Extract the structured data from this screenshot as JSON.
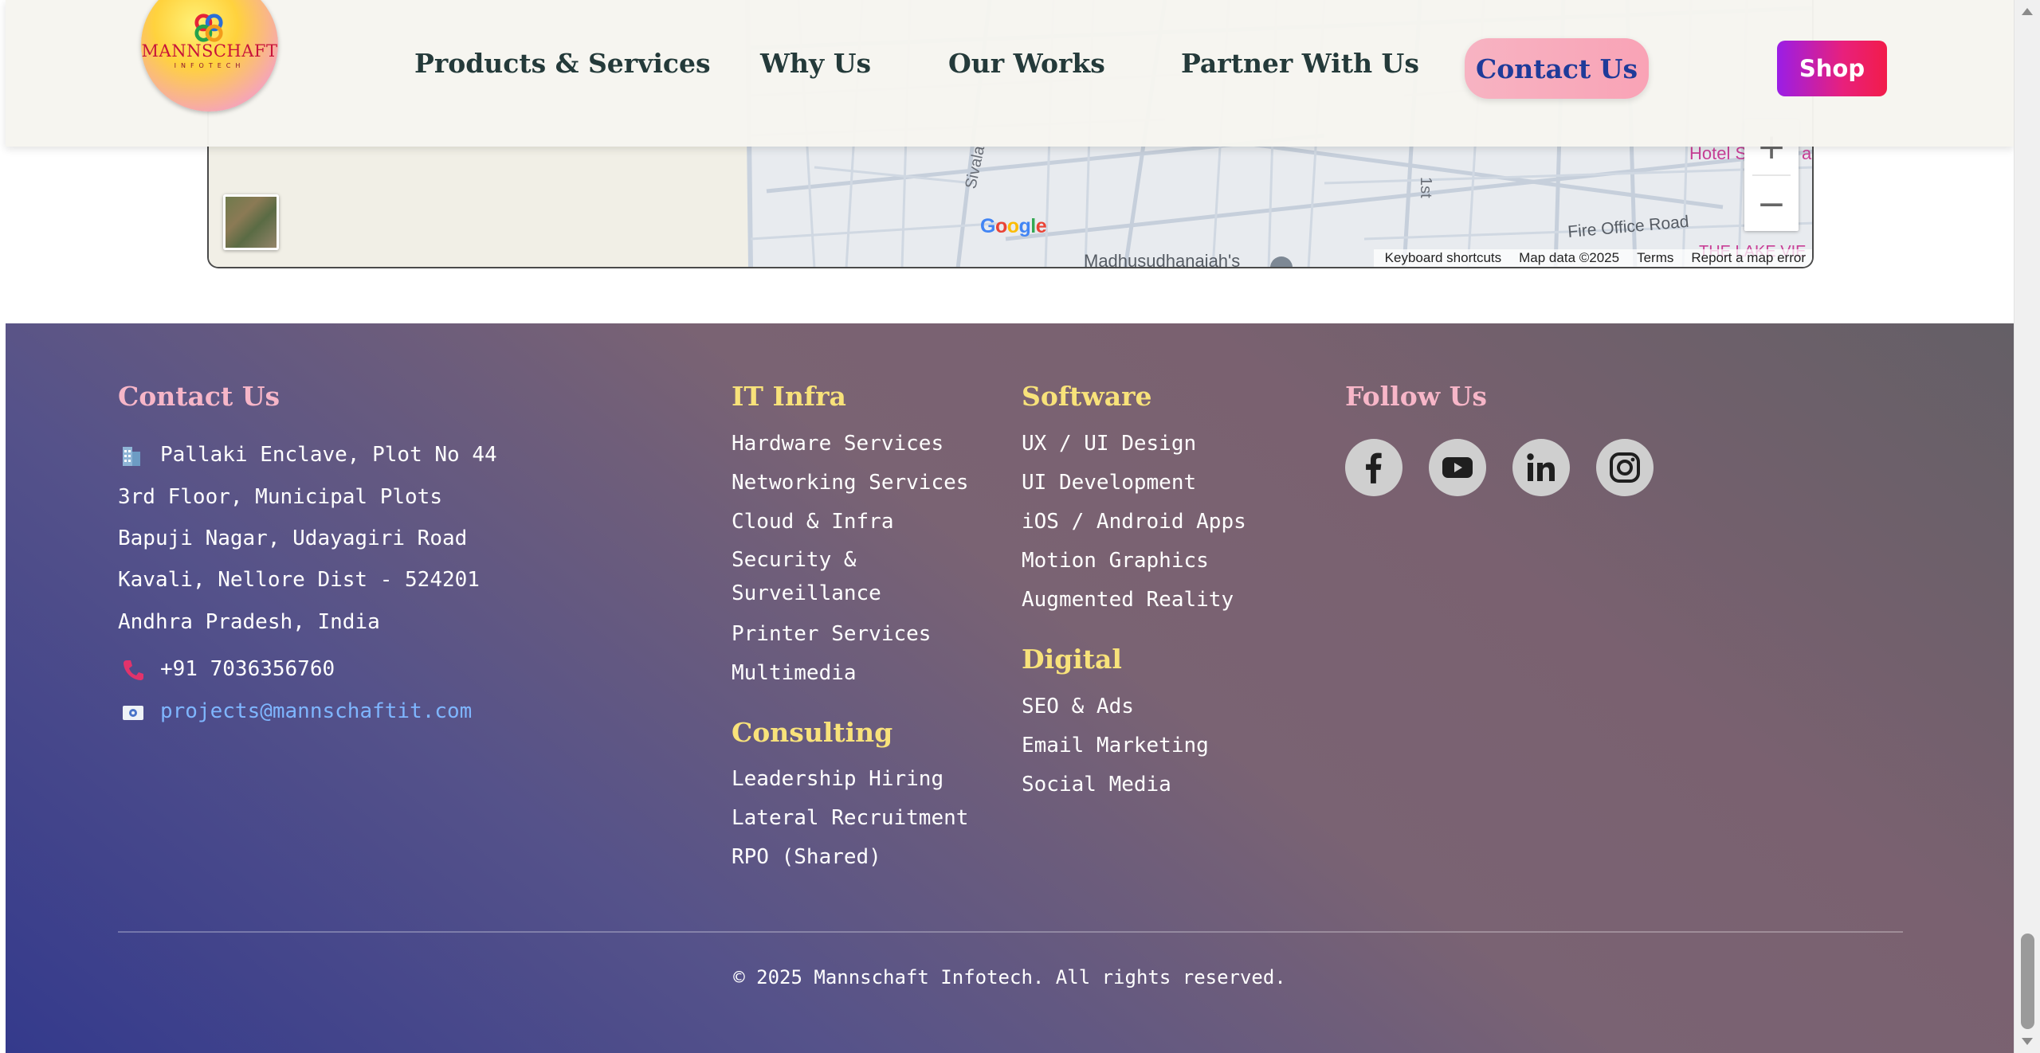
{
  "header": {
    "logo_text": "MANNSCHAFT",
    "logo_subtext": "INFOTECH",
    "nav": [
      {
        "label": "Products & Services"
      },
      {
        "label": "Why Us"
      },
      {
        "label": "Our Works"
      },
      {
        "label": "Partner With Us"
      },
      {
        "label": "Contact Us"
      }
    ],
    "shop_label": "Shop"
  },
  "map": {
    "google_logo": "Google",
    "labels": {
      "street": "Sivala",
      "place": "Hotel S",
      "place2": "ari",
      "road": "Fire Office Road",
      "lake": "THE LAKE VIE",
      "poi": "Madhusudhanaiah's",
      "side": "1st"
    },
    "attribution": {
      "keyboard": "Keyboard shortcuts",
      "data": "Map data ©2025",
      "terms": "Terms",
      "report": "Report a map error"
    }
  },
  "footer": {
    "contact": {
      "heading": "Contact Us",
      "address": [
        "Pallaki Enclave, Plot No 44",
        "3rd Floor, Municipal Plots",
        "Bapuji Nagar, Udayagiri Road",
        "Kavali, Nellore Dist - 524201",
        "Andhra Pradesh, India"
      ],
      "phone": "+91 7036356760",
      "email": "projects@mannschaftit.com"
    },
    "it_infra": {
      "heading": "IT Infra",
      "items": [
        "Hardware Services",
        "Networking Services",
        "Cloud & Infra",
        "Security & Surveillance",
        "Printer Services",
        "Multimedia"
      ]
    },
    "consulting": {
      "heading": "Consulting",
      "items": [
        "Leadership Hiring",
        "Lateral Recruitment",
        "RPO (Shared)"
      ]
    },
    "software": {
      "heading": "Software",
      "items": [
        "UX / UI Design",
        "UI Development",
        "iOS / Android Apps",
        "Motion Graphics",
        "Augmented Reality"
      ]
    },
    "digital": {
      "heading": "Digital",
      "items": [
        "SEO & Ads",
        "Email Marketing",
        "Social Media"
      ]
    },
    "follow": {
      "heading": "Follow Us",
      "icons": [
        "facebook-icon",
        "youtube-icon",
        "linkedin-icon",
        "instagram-icon"
      ]
    },
    "copyright": "© 2025 Mannschaft Infotech. All rights reserved."
  },
  "colors": {
    "heading_pink": "#f7b6c8",
    "heading_yellow": "#f8e27a",
    "contact_button": "#f9a3b6",
    "contact_button_text": "#1f3b99",
    "shop_gradient_start": "#9a1ee6",
    "shop_gradient_end": "#f21c4a",
    "email_link": "#7fb6ff"
  }
}
